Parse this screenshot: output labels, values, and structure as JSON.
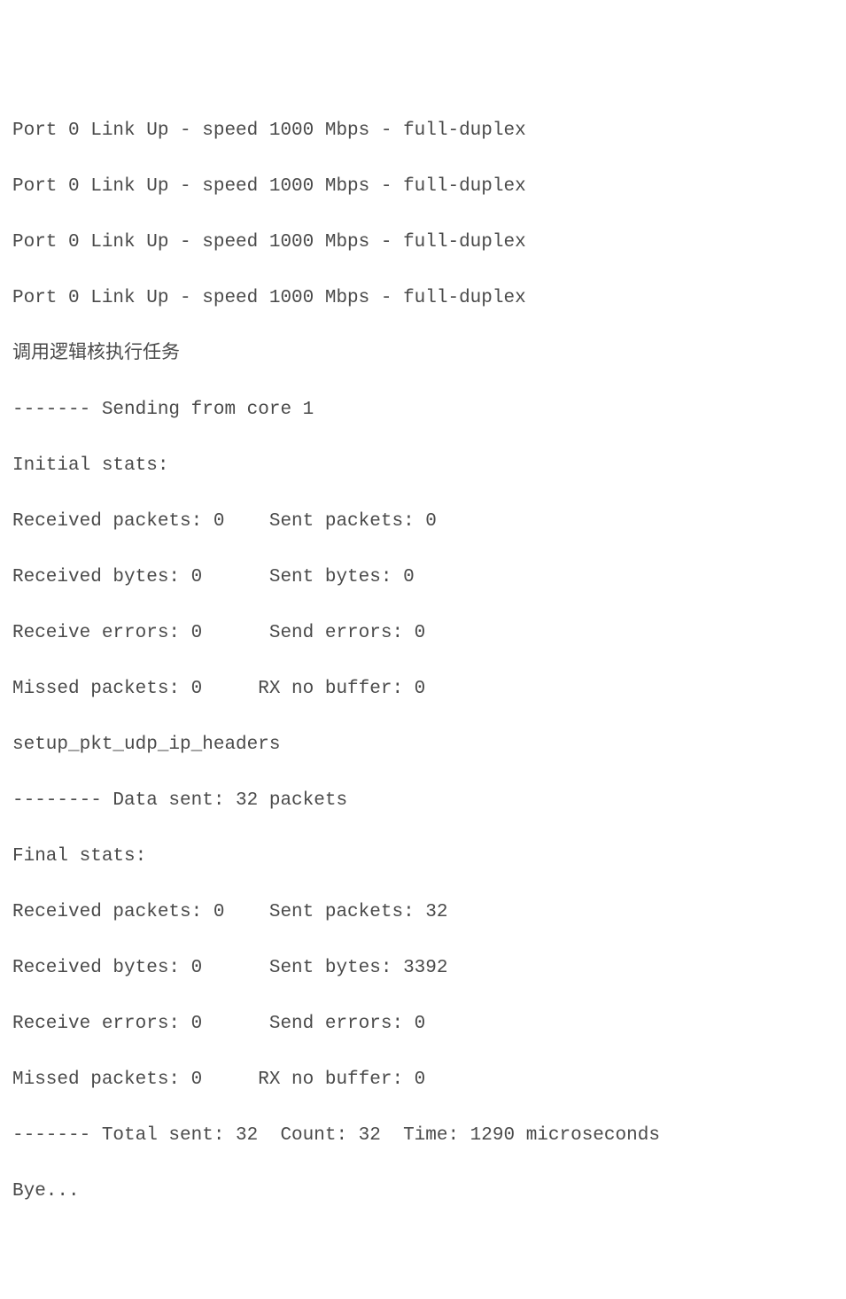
{
  "lines": {
    "l0": "Port 0 Link Up - speed 1000 Mbps - full-duplex",
    "l1": "Port 0 Link Up - speed 1000 Mbps - full-duplex",
    "l2": "Port 0 Link Up - speed 1000 Mbps - full-duplex",
    "l3": "Port 0 Link Up - speed 1000 Mbps - full-duplex",
    "l4": "调用逻辑核执行任务",
    "l5": "------- Sending from core 1",
    "l6": "Initial stats:",
    "l7": "Received packets: 0    Sent packets: 0",
    "l8": "Received bytes: 0      Sent bytes: 0",
    "l9": "Receive errors: 0      Send errors: 0",
    "l10": "Missed packets: 0     RX no buffer: 0",
    "l11": "setup_pkt_udp_ip_headers",
    "l12": "-------- Data sent: 32 packets",
    "l13": "Final stats:",
    "l14": "Received packets: 0    Sent packets: 32",
    "l15": "Received bytes: 0      Sent bytes: 3392",
    "l16": "Receive errors: 0      Send errors: 0",
    "l17": "Missed packets: 0     RX no buffer: 0",
    "l18": "------- Total sent: 32  Count: 32  Time: 1290 microseconds",
    "l19": "Bye..."
  }
}
